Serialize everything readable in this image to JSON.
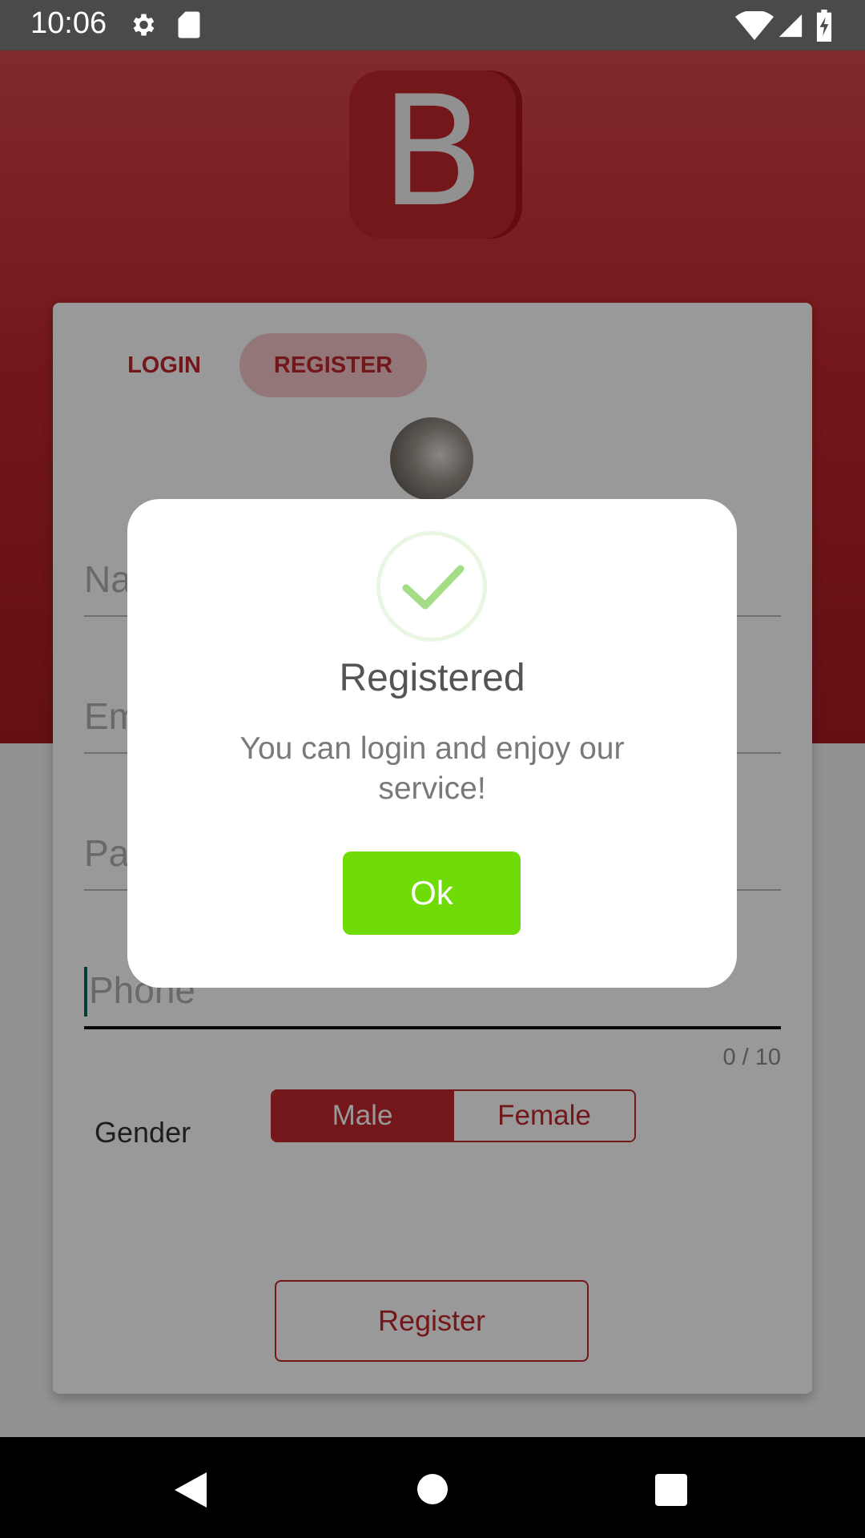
{
  "status_bar": {
    "time": "10:06",
    "icons": [
      "gear-icon",
      "sd-card-icon",
      "wifi-icon",
      "signal-icon",
      "battery-charging-icon"
    ]
  },
  "app": {
    "logo_letter": "B",
    "tabs": [
      {
        "label": "LOGIN",
        "selected": false
      },
      {
        "label": "REGISTER",
        "selected": true
      }
    ],
    "form": {
      "name_placeholder": "Na",
      "email_placeholder": "Em",
      "password_placeholder": "Pa",
      "phone_placeholder": "Phone",
      "phone_counter": "0 / 10",
      "gender_label": "Gender",
      "gender_options": [
        "Male",
        "Female"
      ],
      "gender_selected": "Male",
      "register_button": "Register"
    }
  },
  "dialog": {
    "icon": "checkmark-icon",
    "title": "Registered",
    "message": "You can login and enjoy our service!",
    "ok_label": "Ok"
  },
  "nav_bar": {
    "icons": [
      "back-icon",
      "home-icon",
      "recents-icon"
    ]
  },
  "colors": {
    "brand_red": "#c1272d",
    "ok_green": "#6fdc08",
    "check_green": "#a5dc86"
  }
}
